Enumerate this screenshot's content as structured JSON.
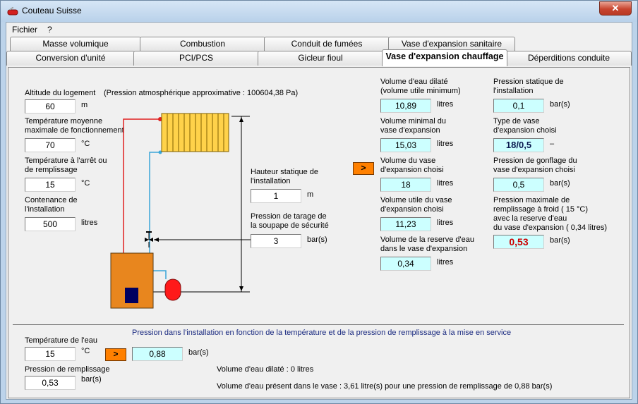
{
  "window": {
    "title": "Couteau Suisse",
    "close_glyph": "✕"
  },
  "menu": {
    "items": [
      "Fichier",
      "?"
    ]
  },
  "tabs": {
    "row1": [
      "Masse volumique",
      "Combustion",
      "Conduit de fumées",
      "Vase d'expansion sanitaire"
    ],
    "row2": [
      "Conversion d'unité",
      "PCI/PCS",
      "Gicleur fioul",
      "Vase d'expansion chauffage",
      "Déperditions conduite"
    ],
    "active": "Vase d'expansion chauffage"
  },
  "inputs": {
    "altitude": {
      "label": "Altitude du logement",
      "value": "60",
      "unit": "m"
    },
    "pressure_note": "(Pression atmosphérique approximative : 100604,38 Pa)",
    "temp_max": {
      "label_line1": "Température moyenne",
      "label_line2": "maximale de fonctionnement",
      "value": "70",
      "unit": "°C"
    },
    "temp_stop": {
      "label_line1": "Température à l'arrêt ou",
      "label_line2": "de remplissage",
      "value": "15",
      "unit": "°C"
    },
    "contenance": {
      "label_line1": "Contenance de",
      "label_line2": "l'installation",
      "value": "500",
      "unit": "litres"
    },
    "hauteur": {
      "label_line1": "Hauteur statique de",
      "label_line2": "l'installation",
      "value": "1",
      "unit": "m"
    },
    "tarage": {
      "label_line1": "Pression de tarage de",
      "label_line2": "la soupape de sécurité",
      "value": "3",
      "unit": "bar(s)"
    }
  },
  "results_col1": [
    {
      "label_line1": "Volume d'eau dilaté",
      "label_line2": "(volume utile minimum)",
      "value": "10,89",
      "unit": "litres"
    },
    {
      "label_line1": "Volume minimal du",
      "label_line2": "vase d'expansion",
      "value": "15,03",
      "unit": "litres"
    },
    {
      "label_line1": "Volume du vase",
      "label_line2": "d'expansion choisi",
      "value": "18",
      "unit": "litres"
    },
    {
      "label_line1": "Volume utile du vase",
      "label_line2": "d'expansion choisi",
      "value": "11,23",
      "unit": "litres"
    },
    {
      "label_line1": "Volume de la reserve d'eau",
      "label_line2": "dans le vase d'expansion",
      "value": "0,34",
      "unit": "litres"
    }
  ],
  "results_col2": {
    "pstat": {
      "label_line1": "Pression statique de",
      "label_line2": "l'installation",
      "value": "0,1",
      "unit": "bar(s)"
    },
    "type": {
      "label_line1": "Type de vase",
      "label_line2": "d'expansion choisi",
      "value": "18/0,5",
      "unit": "–"
    },
    "gonflage": {
      "label_line1": "Pression de gonflage du",
      "label_line2": "vase d'expansion choisi",
      "value": "0,5",
      "unit": "bar(s)"
    },
    "pmax": {
      "label_line1": "Pression maximale de",
      "label_line2": "remplissage à froid ( 15 °C)",
      "label_line3": "avec la reserve d'eau",
      "label_line4": "du vase d'expansion ( 0,34 litres)",
      "value": "0,53",
      "unit": "bar(s)"
    }
  },
  "calc_arrow": ">",
  "bottom": {
    "heading": "Pression dans l'installation en fonction de la température et de la pression de remplissage à la mise en service",
    "temp": {
      "label": "Température de l'eau",
      "value": "15",
      "unit": "°C"
    },
    "result": {
      "value": "0,88",
      "unit": "bar(s)"
    },
    "remplissage": {
      "label": "Pression de remplissage",
      "value": "0,53",
      "unit": "bar(s)"
    },
    "dilate": "Volume d'eau dilaté : 0 litres",
    "vase": "Volume d'eau présent dans le vase : 3,61 litre(s) pour une pression de remplissage de 0,88 bar(s)"
  },
  "colors": {
    "boiler": "#e8861e",
    "radiator": "#ffd24a",
    "hot_pipe": "#e02020",
    "cold_pipe": "#3aa6d8",
    "vessel": "#ff1a1a"
  }
}
